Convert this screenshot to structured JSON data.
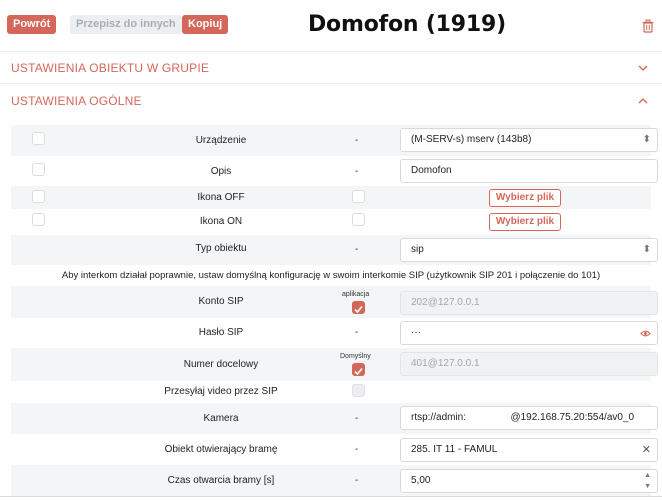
{
  "header": {
    "back_label": "Powrót",
    "move_label": "Przepisz do innych",
    "copy_label": "Kopiuj",
    "title": "Domofon (1919)"
  },
  "sections": {
    "group_settings": "USTAWIENIA OBIEKTU W GRUPIE",
    "general_settings": "USTAWIENIA OGÓLNE"
  },
  "rows": {
    "device": {
      "label": "Urządzenie",
      "dash": "-",
      "value": "(M-SERV-s) mserv (143b8)"
    },
    "description": {
      "label": "Opis",
      "dash": "-",
      "value": "Domofon"
    },
    "icon_off": {
      "label": "Ikona OFF",
      "button": "Wybierz plik"
    },
    "icon_on": {
      "label": "Ikona ON",
      "button": "Wybierz plik"
    },
    "object_type": {
      "label": "Typ obiektu",
      "dash": "-",
      "value": "sip"
    },
    "info_note": "Aby interkom działał poprawnie, ustaw domyślną konfigurację w swoim interkomie SIP (użytkownik SIP 201 i połączenie do 101)",
    "sip_account": {
      "label": "Konto SIP",
      "tag": "aplikacja",
      "value": "202@127.0.0.1"
    },
    "sip_password": {
      "label": "Hasło SIP",
      "dash": "-",
      "value": "···"
    },
    "target_number": {
      "label": "Numer docelowy",
      "tag": "Domyślny",
      "value": "401@127.0.0.1"
    },
    "video_sip": {
      "label": "Przesyłaj video przez SIP"
    },
    "camera": {
      "label": "Kamera",
      "dash": "-",
      "value": "rtsp://admin:                @192.168.75.20:554/av0_0"
    },
    "gate_object": {
      "label": "Obiekt otwierający bramę",
      "dash": "-",
      "value": "285. IT 11 - FAMUL"
    },
    "gate_time": {
      "label": "Czas otwarcia bramy [s]",
      "dash": "-",
      "value": "5,00"
    }
  },
  "colors": {
    "accent": "#d4675a",
    "row_alt": "#f4f5f7"
  }
}
